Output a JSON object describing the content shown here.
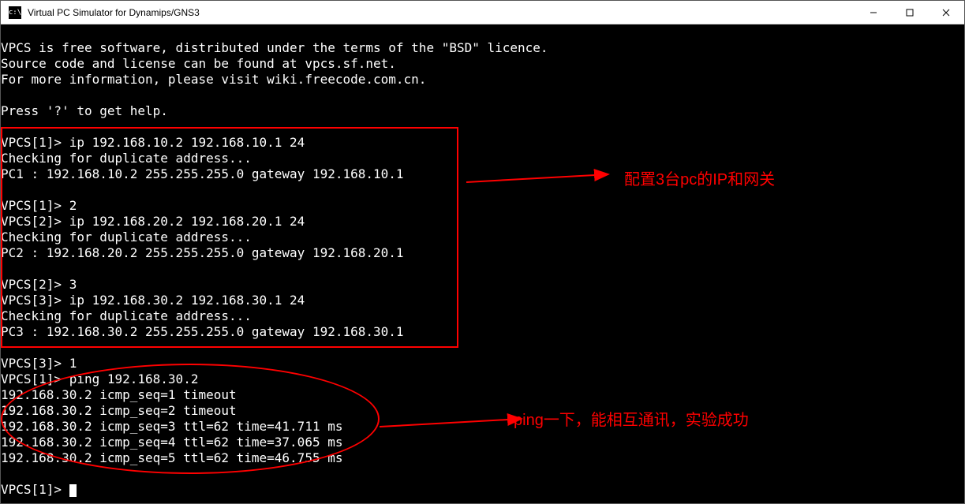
{
  "window": {
    "title": "Virtual PC Simulator for Dynamips/GNS3"
  },
  "terminal": {
    "lines": [
      "",
      "VPCS is free software, distributed under the terms of the \"BSD\" licence.",
      "Source code and license can be found at vpcs.sf.net.",
      "For more information, please visit wiki.freecode.com.cn.",
      "",
      "Press '?' to get help.",
      "",
      "VPCS[1]> ip 192.168.10.2 192.168.10.1 24",
      "Checking for duplicate address...",
      "PC1 : 192.168.10.2 255.255.255.0 gateway 192.168.10.1",
      "",
      "VPCS[1]> 2",
      "VPCS[2]> ip 192.168.20.2 192.168.20.1 24",
      "Checking for duplicate address...",
      "PC2 : 192.168.20.2 255.255.255.0 gateway 192.168.20.1",
      "",
      "VPCS[2]> 3",
      "VPCS[3]> ip 192.168.30.2 192.168.30.1 24",
      "Checking for duplicate address...",
      "PC3 : 192.168.30.2 255.255.255.0 gateway 192.168.30.1",
      "",
      "VPCS[3]> 1",
      "VPCS[1]> ping 192.168.30.2",
      "192.168.30.2 icmp_seq=1 timeout",
      "192.168.30.2 icmp_seq=2 timeout",
      "192.168.30.2 icmp_seq=3 ttl=62 time=41.711 ms",
      "192.168.30.2 icmp_seq=4 ttl=62 time=37.065 ms",
      "192.168.30.2 icmp_seq=5 ttl=62 time=46.755 ms",
      "",
      "VPCS[1]> "
    ]
  },
  "annotations": {
    "label_ip_config": "配置3台pc的IP和网关",
    "label_ping": "ping一下，能相互通讯，实验成功"
  }
}
